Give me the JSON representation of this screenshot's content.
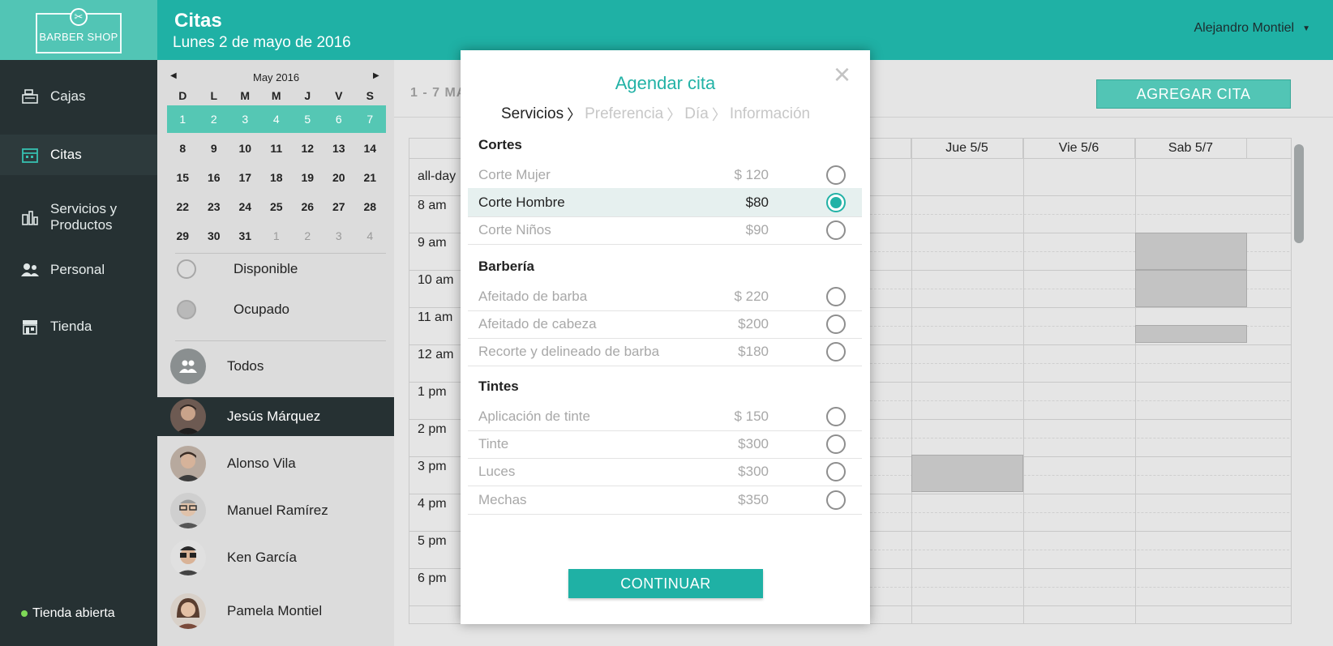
{
  "brand": {
    "logo_text": "BARBER SHOP"
  },
  "header": {
    "title": "Citas",
    "date": "Lunes 2 de mayo de 2016",
    "user_name": "Alejandro Montiel"
  },
  "sidebar": {
    "items": [
      {
        "label": "Cajas",
        "icon": "cash-register-icon",
        "active": false
      },
      {
        "label": "Citas",
        "icon": "calendar-icon",
        "active": true
      },
      {
        "label": "Servicios y Productos",
        "icon": "products-icon",
        "active": false
      },
      {
        "label": "Personal",
        "icon": "staff-icon",
        "active": false
      },
      {
        "label": "Tienda",
        "icon": "store-icon",
        "active": false
      }
    ],
    "store_status": "Tienda abierta"
  },
  "mini_calendar": {
    "month": "May 2016",
    "weekdays": [
      "D",
      "L",
      "M",
      "M",
      "J",
      "V",
      "S"
    ],
    "weeks": [
      [
        "1",
        "2",
        "3",
        "4",
        "5",
        "6",
        "7"
      ],
      [
        "8",
        "9",
        "10",
        "11",
        "12",
        "13",
        "14"
      ],
      [
        "15",
        "16",
        "17",
        "18",
        "19",
        "20",
        "21"
      ],
      [
        "22",
        "23",
        "24",
        "25",
        "26",
        "27",
        "28"
      ],
      [
        "29",
        "30",
        "31",
        "1",
        "2",
        "3",
        "4"
      ]
    ],
    "highlight_week": 0
  },
  "legend": {
    "available": "Disponible",
    "busy": "Ocupado"
  },
  "staff": [
    {
      "name": "Todos"
    },
    {
      "name": "Jesús Márquez"
    },
    {
      "name": "Alonso Vila"
    },
    {
      "name": "Manuel Ramírez"
    },
    {
      "name": "Ken García"
    },
    {
      "name": "Pamela Montiel"
    }
  ],
  "main": {
    "week_range": "1 - 7  MA",
    "add_button": "AGREGAR CITA",
    "columns": [
      "e 5/4",
      "Jue 5/5",
      "Vie 5/6",
      "Sab 5/7"
    ],
    "all_day_label": "all-day",
    "hours": [
      "8 am",
      "9 am",
      "10 am",
      "11 am",
      "12 am",
      "1 pm",
      "2 pm",
      "3 pm",
      "4 pm",
      "5 pm",
      "6 pm"
    ]
  },
  "modal": {
    "title": "Agendar cita",
    "steps": [
      "Servicios",
      "Preferencia",
      "Día",
      "Información"
    ],
    "sections": [
      {
        "title": "Cortes",
        "services": [
          {
            "name": "Corte Mujer",
            "price": "$ 120",
            "selected": false
          },
          {
            "name": "Corte Hombre",
            "price": "$80",
            "selected": true
          },
          {
            "name": "Corte Niños",
            "price": "$90",
            "selected": false
          }
        ]
      },
      {
        "title": "Barbería",
        "services": [
          {
            "name": "Afeitado de barba",
            "price": "$ 220",
            "selected": false
          },
          {
            "name": "Afeitado de cabeza",
            "price": "$200",
            "selected": false
          },
          {
            "name": "Recorte y delineado de barba",
            "price": "$180",
            "selected": false
          }
        ]
      },
      {
        "title": "Tintes",
        "services": [
          {
            "name": "Aplicación de tinte",
            "price": "$ 150",
            "selected": false
          },
          {
            "name": "Tinte",
            "price": "$300",
            "selected": false
          },
          {
            "name": "Luces",
            "price": "$300",
            "selected": false
          },
          {
            "name": "Mechas",
            "price": "$350",
            "selected": false
          }
        ]
      }
    ],
    "continue_button": "CONTINUAR"
  },
  "colors": {
    "accent": "#1fb1a5",
    "sidebar": "#263133",
    "highlight": "#55c7b4"
  }
}
